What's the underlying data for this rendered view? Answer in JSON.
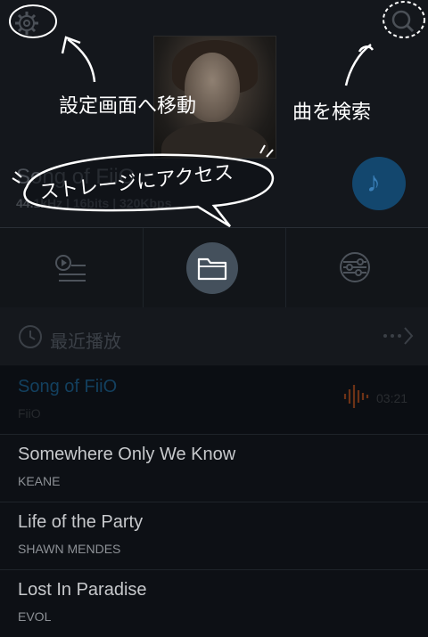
{
  "now_playing": {
    "title": "Song of FiiO",
    "meta": "44.1kHz | 16bits | 320Kbps"
  },
  "annotations": {
    "settings": "設定画面へ移動",
    "search": "曲を検索",
    "storage": "ストレージにアクセス"
  },
  "recent": {
    "label": "最近播放"
  },
  "songs": [
    {
      "title": "Song of FiiO",
      "artist": "FiiO",
      "time": "03:21"
    },
    {
      "title": "Somewhere Only We Know",
      "artist": "KEANE"
    },
    {
      "title": "Life of the Party",
      "artist": "SHAWN MENDES"
    },
    {
      "title": "Lost In Paradise",
      "artist": "EVOL"
    }
  ],
  "colors": {
    "accent": "#1e6ea8",
    "playing_wave": "#b8541c",
    "background": "#0d1015"
  },
  "icons": [
    "gear-icon",
    "search-icon",
    "music-note-icon",
    "playlist-icon",
    "folder-icon",
    "equalizer-icon",
    "clock-icon",
    "more-icon",
    "waveform-icon"
  ]
}
